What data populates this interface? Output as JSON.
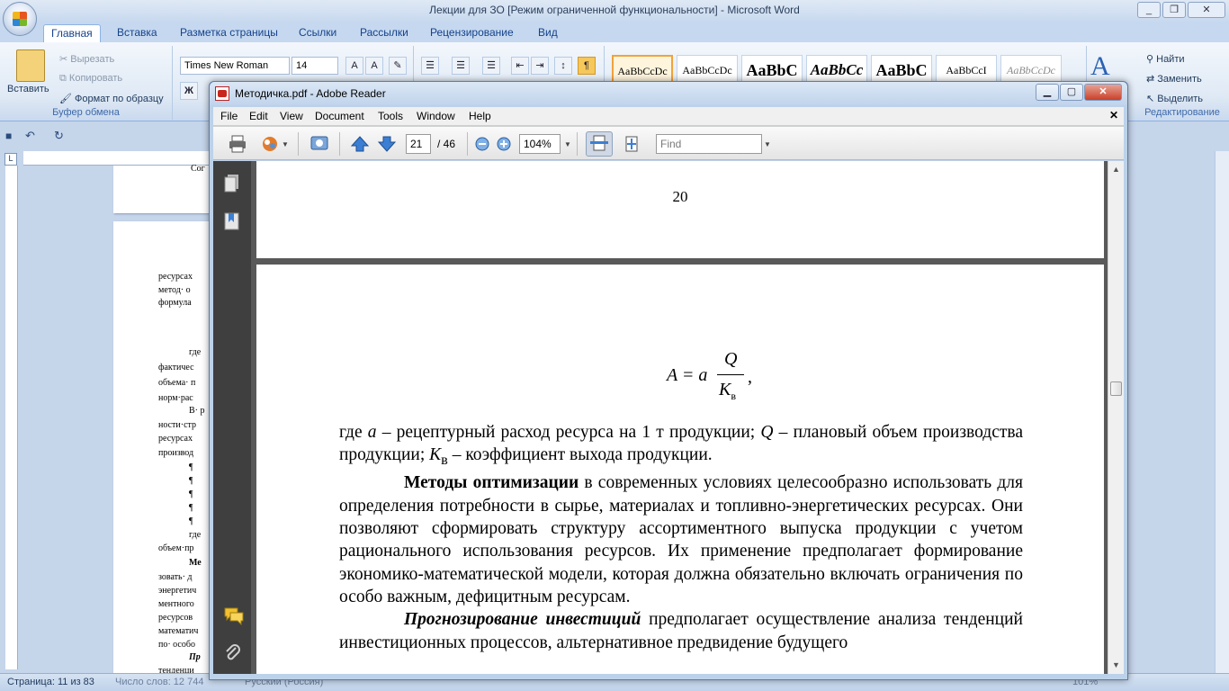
{
  "word": {
    "title": "Лекции для ЗО [Режим ограниченной функциональности] - Microsoft Word",
    "tabs": [
      "Главная",
      "Вставка",
      "Разметка страницы",
      "Ссылки",
      "Рассылки",
      "Рецензирование",
      "Вид"
    ],
    "clipboard": {
      "paste": "Вставить",
      "cut": "Вырезать",
      "copy": "Копировать",
      "format_painter": "Формат по образцу",
      "group_label": "Буфер обмена"
    },
    "font": {
      "name": "Times New Roman",
      "size": "14"
    },
    "styles": [
      "AaBbCcDc",
      "AaBbCcDc",
      "AaBbC",
      "AaBbCc",
      "AaBbC",
      "AaBbCcI",
      "AaBbCcDc"
    ],
    "editing": {
      "find": "Найти",
      "replace": "Заменить",
      "select": "Выделить",
      "group_label": "Редактирование"
    },
    "page_snippets": [
      "Сог",
      "ресурсах",
      "метод· о",
      "формула",
      "где",
      "фактичес",
      "объема· п",
      "норм·рас",
      "В· р",
      "ности·стр",
      "ресурсах",
      "производ",
      "¶",
      "¶",
      "¶",
      "¶",
      "¶",
      "где",
      "объем·пр",
      "Ме",
      "зовать· д",
      "энергетич",
      "ментного",
      "ресурсов",
      "математич",
      "по· особо",
      "Пр",
      "тенденци"
    ],
    "status": {
      "page": "Страница: 11 из 83",
      "words": "Число слов: 12 744",
      "language": "Русский (Россия)",
      "zoom": "101%"
    }
  },
  "reader": {
    "title": "Методичка.pdf - Adobe Reader",
    "menu": [
      "File",
      "Edit",
      "View",
      "Document",
      "Tools",
      "Window",
      "Help"
    ],
    "page_current": "21",
    "page_total": "/ 46",
    "zoom": "104%",
    "find_placeholder": "Find",
    "page_number_label": "20",
    "formula": {
      "lhs": "A = a",
      "numerator": "Q",
      "denominator": "K",
      "denominator_sub": "в",
      "trailing": ","
    },
    "paragraphs": [
      {
        "indent": false,
        "html": "где <i>a</i> – рецептурный расход ресурса на 1 т продукции; <i>Q</i> – плановый объем производства продукции; <i>K</i><sub>в</sub> – коэффициент выхода продукции."
      },
      {
        "indent": true,
        "html": "<b>Методы оптимизации</b> в современных условиях целесообразно использовать для определения потребности в сырье, материалах и топливно-энергетических ресурсах. Они позволяют сформировать структуру ассортиментного выпуска продукции с учетом рационального использования ресурсов. Их применение предполагает формирование экономико-математической модели, которая должна обязательно включать ограничения по особо важным, дефицитным ресурсам."
      },
      {
        "indent": true,
        "html": "<b><i>Прогнозирование инвестиций</i></b> предполагает осуществление анализа тенденций инвестиционных процессов, альтернативное предвидение будущего"
      }
    ]
  }
}
